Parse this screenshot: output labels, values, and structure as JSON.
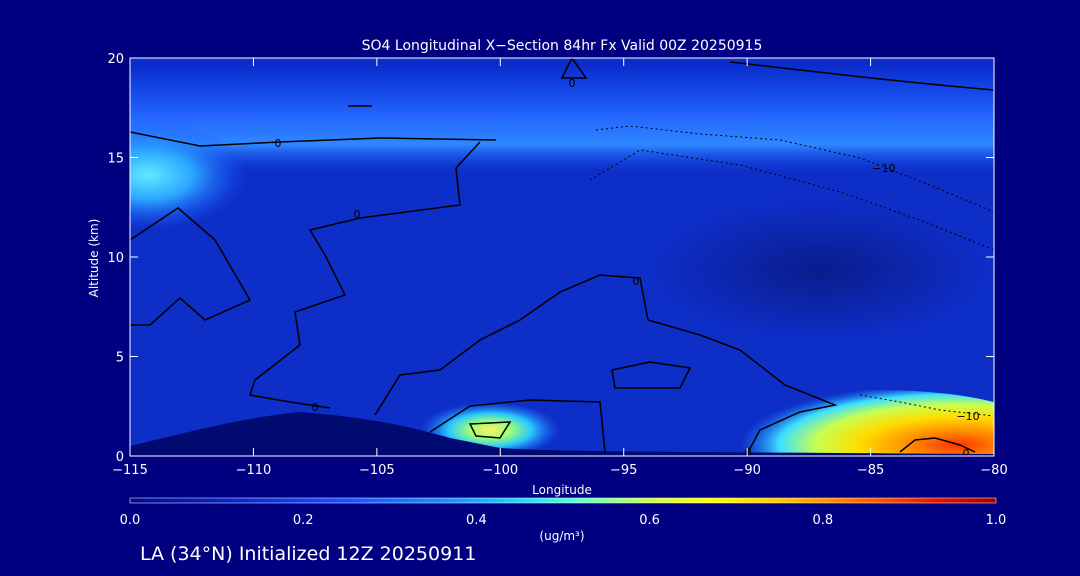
{
  "chart_data": {
    "type": "heatmap",
    "title": "SO4 Longitudinal X−Section 84hr  Fx Valid 00Z 20250915",
    "xlabel": "Longitude",
    "ylabel": "Altitude (km)",
    "xlim": [
      -115,
      -80
    ],
    "ylim": [
      0,
      20
    ],
    "x_ticks": [
      -115,
      -110,
      -105,
      -100,
      -95,
      -90,
      -85,
      -80
    ],
    "x_tick_labels": [
      "−115",
      "−110",
      "−105",
      "−100",
      "−95",
      "−90",
      "−85",
      "−80"
    ],
    "y_ticks": [
      0,
      5,
      10,
      15,
      20
    ],
    "y_tick_labels": [
      "0",
      "5",
      "10",
      "15",
      "20"
    ],
    "grid": false,
    "colorbar": {
      "label": "(ug/m³)",
      "min": 0.0,
      "max": 1.0,
      "ticks": [
        0.0,
        0.2,
        0.4,
        0.6,
        0.8,
        1.0
      ],
      "tick_labels": [
        "0.0",
        "0.2",
        "0.4",
        "0.6",
        "0.8",
        "1.0"
      ],
      "orientation": "horizontal"
    },
    "contour_labels": [
      "0",
      "0",
      "0",
      "0",
      "0",
      "0",
      "−10",
      "−10",
      "0"
    ],
    "colors": {
      "background": "#000080",
      "low": "#0a1fb4",
      "mid": "#2f8cff",
      "high": "#ffe000",
      "peak": "#e02000",
      "terrain": "#000a70"
    },
    "features": [
      {
        "name": "upper-band",
        "lon": [
          -115,
          -80
        ],
        "alt_km": [
          15,
          19
        ],
        "value": 0.28
      },
      {
        "name": "west-upper-max",
        "lon": -114,
        "alt_km": 14,
        "value": 0.42
      },
      {
        "name": "east-surface-max",
        "lon": -82,
        "alt_km": 0.8,
        "value": 0.85
      },
      {
        "name": "mid-surface-max",
        "lon": -100,
        "alt_km": 1.0,
        "value": 0.55
      },
      {
        "name": "mid-troposphere-min",
        "lon": -87,
        "alt_km": 9,
        "value": 0.08
      }
    ]
  },
  "footer": {
    "text": "LA (34°N) Initialized 12Z 20250911"
  }
}
